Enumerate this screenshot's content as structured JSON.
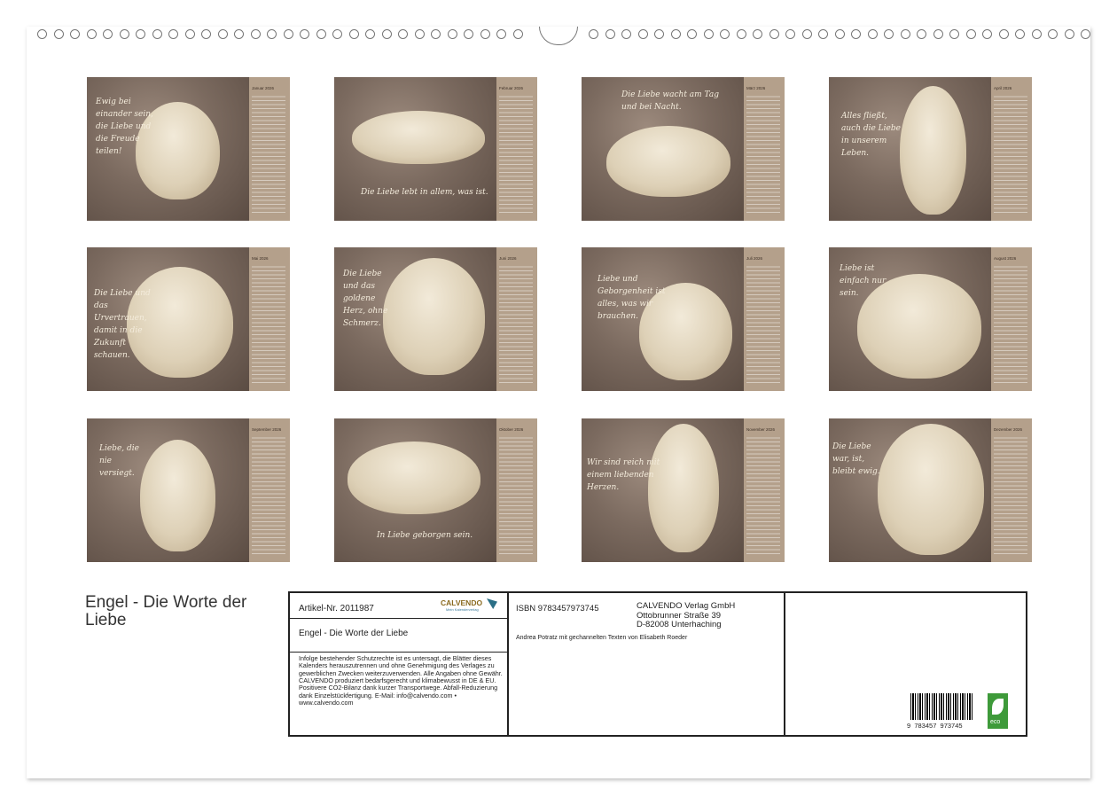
{
  "months": [
    {
      "name": "Januar 2026",
      "quote": "Ewig bei einander sein, die Liebe und die Freude teilen!"
    },
    {
      "name": "Februar 2026",
      "quote": "Die Liebe lebt in allem, was ist."
    },
    {
      "name": "März 2026",
      "quote": "Die Liebe wacht am Tag und bei Nacht."
    },
    {
      "name": "April 2026",
      "quote": "Alles fließt, auch die Liebe in unserem Leben."
    },
    {
      "name": "Mai 2026",
      "quote": "Die Liebe und das Urvertrauen, damit in die Zukunft schauen."
    },
    {
      "name": "Juni 2026",
      "quote": "Die Liebe und das goldene Herz, ohne Schmerz."
    },
    {
      "name": "Juli 2026",
      "quote": "Liebe und Geborgenheit ist alles, was wir brauchen."
    },
    {
      "name": "August 2026",
      "quote": "Liebe ist einfach nur sein."
    },
    {
      "name": "September 2026",
      "quote": "Liebe, die nie versiegt."
    },
    {
      "name": "Oktober 2026",
      "quote": "In Liebe geborgen sein."
    },
    {
      "name": "November 2026",
      "quote": "Wir sind reich mit einem liebenden Herzen."
    },
    {
      "name": "Dezember 2026",
      "quote": "Die Liebe war, ist, bleibt ewig."
    }
  ],
  "title": "Engel - Die Worte der Liebe",
  "info": {
    "article": "Artikel-Nr. 2011987",
    "brand": "CALVENDO",
    "brand_sub": "Mein Kalenderverlag",
    "calendar_title": "Engel - Die Worte der Liebe",
    "legal": "Infolge bestehender Schutzrechte ist es untersagt, die Blätter dieses Kalenders herauszutrennen und ohne Genehmigung des Verlages zu gewerblichen Zwecken weiterzuverwenden. Alle Angaben ohne Gewähr. CALVENDO produziert bedarfsgerecht und klimabewusst in DE & EU. Positivere CO2-Bilanz dank kurzer Transportwege. Abfall-Reduzierung dank Einzelstückfertigung. E-Mail: info@calvendo.com • www.calvendo.com",
    "isbn": "ISBN 9783457973745",
    "publisher": "CALVENDO Verlag GmbH",
    "street": "Ottobrunner Straße 39",
    "city": "D-82008 Unterhaching",
    "author": "Andrea Potratz mit gechannelten Texten von Elisabeth Roeder",
    "barcode_digits": "9  783457  973745",
    "eco_label": "eco"
  }
}
